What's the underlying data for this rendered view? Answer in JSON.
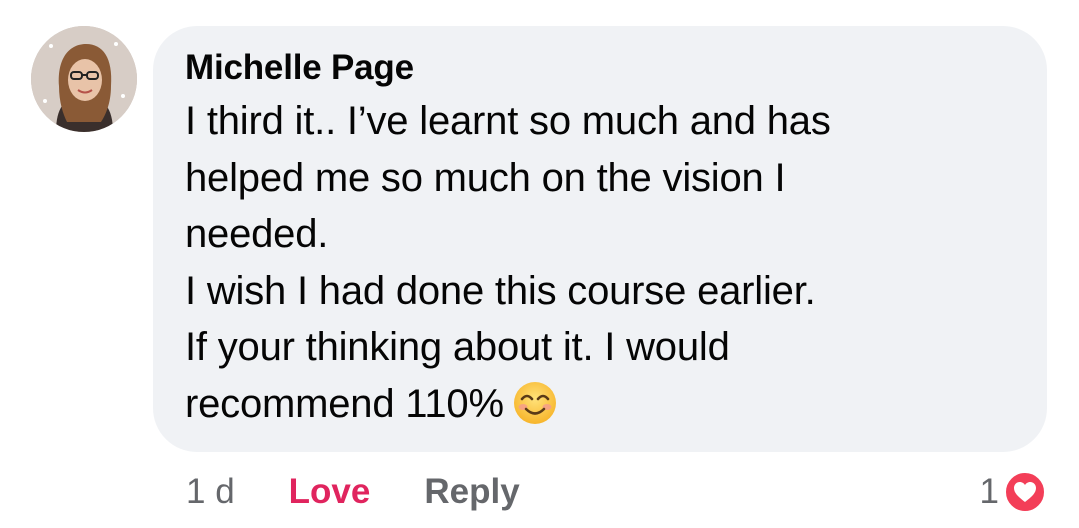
{
  "comment": {
    "author": "Michelle Page",
    "body_lines": [
      "I third it.. I’ve learnt so much and has",
      "helped me so much on the vision I",
      "needed.",
      "I wish I had done this course earlier.",
      "If your thinking about it. I would",
      "recommend 110%"
    ],
    "emoji": "smiling-face-with-smiling-eyes-icon"
  },
  "actions": {
    "time": "1 d",
    "love_label": "Love",
    "reply_label": "Reply"
  },
  "reactions": {
    "count": "1",
    "type": "love-heart-icon"
  },
  "colors": {
    "bubble": "#f0f2f5",
    "love": "#e0245e",
    "muted": "#65676b",
    "heart_badge": "#f33e58"
  }
}
